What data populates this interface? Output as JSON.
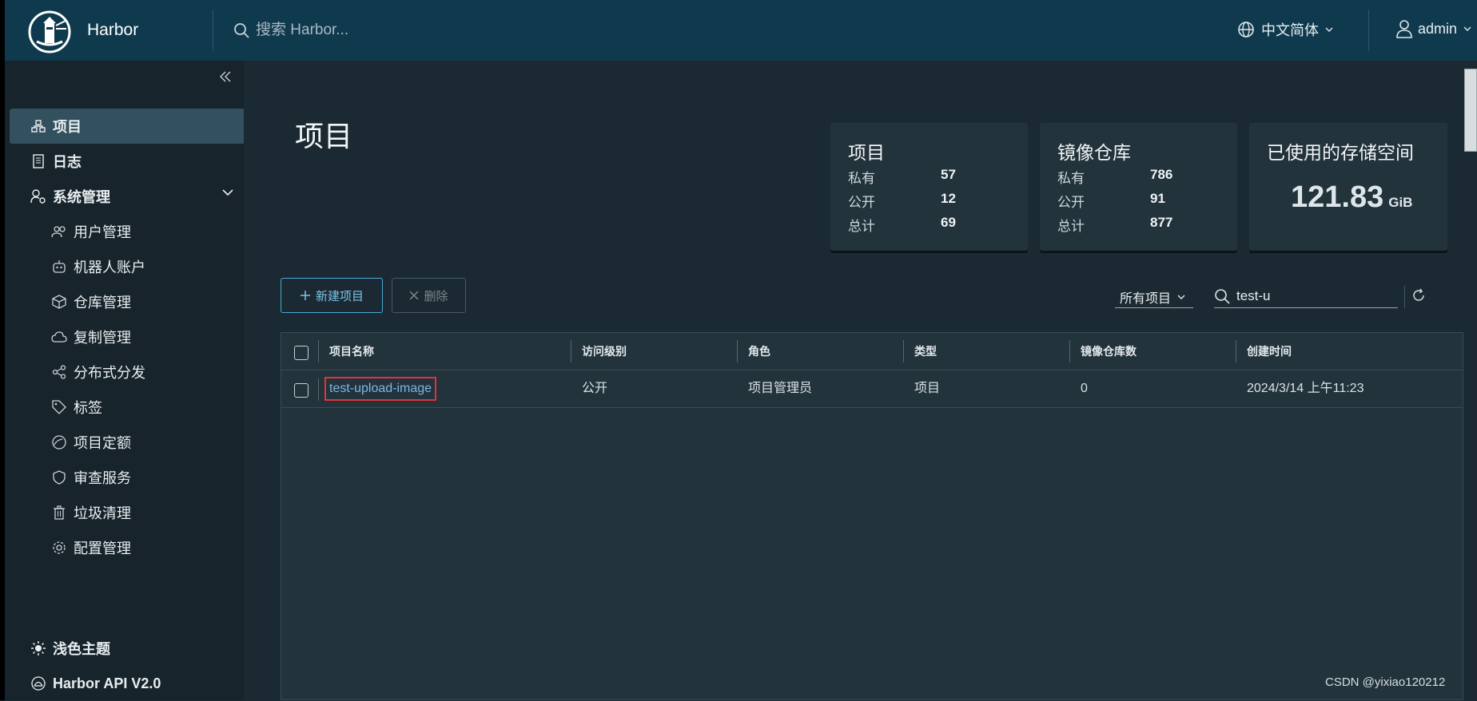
{
  "header": {
    "brand": "Harbor",
    "search_placeholder": "搜索 Harbor...",
    "language": "中文简体",
    "user": "admin"
  },
  "sidebar": {
    "items": [
      {
        "label": "项目",
        "icon": "projects-icon",
        "active": true
      },
      {
        "label": "日志",
        "icon": "log-icon"
      },
      {
        "label": "系统管理",
        "icon": "admin-icon"
      },
      {
        "label": "用户管理",
        "icon": "users-icon"
      },
      {
        "label": "机器人账户",
        "icon": "robot-icon"
      },
      {
        "label": "仓库管理",
        "icon": "box-icon"
      },
      {
        "label": "复制管理",
        "icon": "cloud-icon"
      },
      {
        "label": "分布式分发",
        "icon": "share-icon"
      },
      {
        "label": "标签",
        "icon": "tag-icon"
      },
      {
        "label": "项目定额",
        "icon": "quota-icon"
      },
      {
        "label": "审查服务",
        "icon": "shield-icon"
      },
      {
        "label": "垃圾清理",
        "icon": "trash-icon"
      },
      {
        "label": "配置管理",
        "icon": "gear-icon"
      }
    ],
    "theme": "浅色主题",
    "api": "Harbor API V2.0"
  },
  "main": {
    "title": "项目",
    "cards": {
      "projects": {
        "title": "项目",
        "private_label": "私有",
        "private": "57",
        "public_label": "公开",
        "public": "12",
        "total_label": "总计",
        "total": "69"
      },
      "repos": {
        "title": "镜像仓库",
        "private_label": "私有",
        "private": "786",
        "public_label": "公开",
        "public": "91",
        "total_label": "总计",
        "total": "877"
      },
      "storage": {
        "title": "已使用的存储空间",
        "value": "121.83",
        "unit": "GiB"
      }
    },
    "toolbar": {
      "new_label": "新建项目",
      "delete_label": "删除",
      "filter_label": "所有项目",
      "search_value": "test-u"
    },
    "table": {
      "headers": [
        "项目名称",
        "访问级别",
        "角色",
        "类型",
        "镜像仓库数",
        "创建时间"
      ],
      "rows": [
        {
          "name": "test-upload-image",
          "access": "公开",
          "role": "项目管理员",
          "type": "项目",
          "repos": "0",
          "created": "2024/3/14 上午11:23"
        }
      ]
    }
  },
  "watermark": "CSDN @yixiao120212"
}
